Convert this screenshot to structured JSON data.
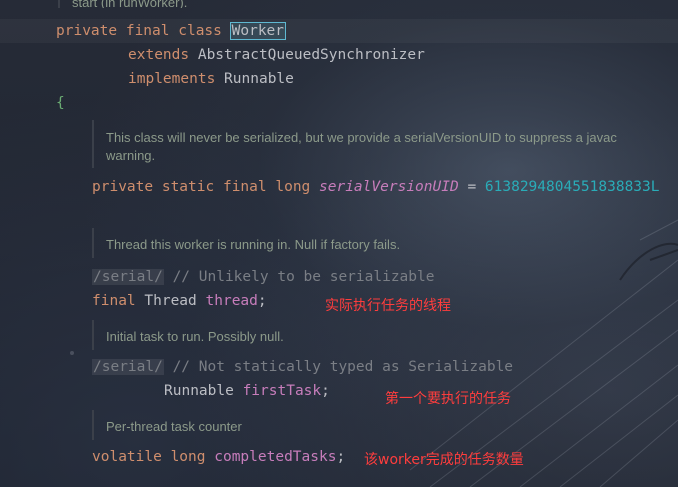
{
  "top_doc": "start (in runWorker).",
  "class_decl": {
    "kw_private": "private",
    "kw_final": "final",
    "kw_class": "class",
    "name": "Worker",
    "kw_extends": "extends",
    "superclass": "AbstractQueuedSynchronizer",
    "kw_implements": "implements",
    "interface": "Runnable",
    "open_brace": "{"
  },
  "doc_serial": "This class will never be serialized, but we provide a serialVersionUID to suppress a javac warning.",
  "serial_field": {
    "kw_private": "private",
    "kw_static": "static",
    "kw_final": "final",
    "kw_long": "long",
    "name": "serialVersionUID",
    "eq": "=",
    "value": "6138294804551838833L"
  },
  "doc_thread": "Thread this worker is running in. Null if factory fails.",
  "thread_field": {
    "tag": "/serial/",
    "comment": "// Unlikely to be serializable",
    "kw_final": "final",
    "type": "Thread",
    "name": "thread",
    "semi": ";",
    "note": "实际执行任务的线程"
  },
  "doc_first": "Initial task to run. Possibly null.",
  "first_task_field": {
    "tag": "/serial/",
    "comment": "// Not statically typed as Serializable",
    "type": "Runnable",
    "name": "firstTask",
    "semi": ";",
    "note": "第一个要执行的任务"
  },
  "doc_counter": "Per-thread task counter",
  "completed_field": {
    "kw_volatile": "volatile",
    "kw_long": "long",
    "name": "completedTasks",
    "semi": ";",
    "note": "该worker完成的任务数量"
  },
  "colors": {
    "keyword": "#cf8e6d",
    "field": "#c77dbb",
    "number": "#2aacb8",
    "comment": "#7a7e85",
    "annotation_note": "#ff3d3d"
  }
}
